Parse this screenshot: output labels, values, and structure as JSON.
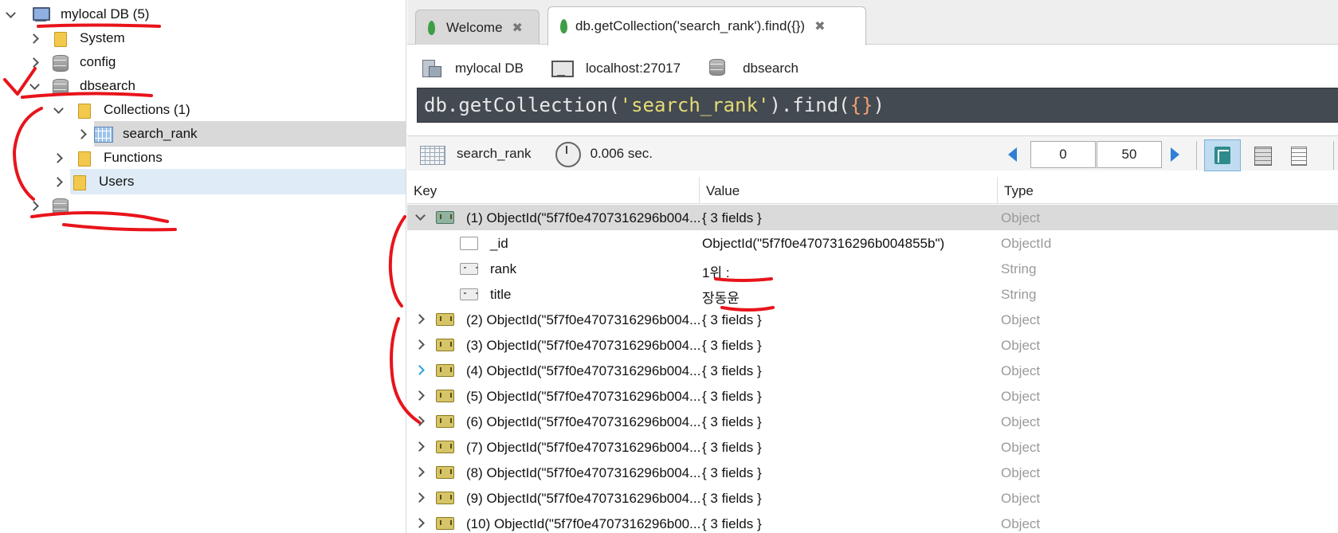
{
  "sidebar": {
    "items": [
      {
        "label": "mylocal DB (5)",
        "icon": "monitor-icon"
      },
      {
        "label": "System",
        "icon": "folder-icon"
      },
      {
        "label": "config",
        "icon": "database-icon"
      },
      {
        "label": "dbsearch",
        "icon": "database-icon"
      },
      {
        "label": "Collections (1)",
        "icon": "folder-icon"
      },
      {
        "label": "search_rank",
        "icon": "table-icon"
      },
      {
        "label": "Functions",
        "icon": "folder-icon"
      },
      {
        "label": "Users",
        "icon": "folder-icon"
      },
      {
        "label": "",
        "icon": "database-icon"
      }
    ]
  },
  "tabs": [
    {
      "label": "Welcome",
      "icon": "leaf-icon",
      "close": "✖"
    },
    {
      "label": "db.getCollection('search_rank').find({})",
      "icon": "leaf-icon",
      "close": "✖"
    }
  ],
  "connection": {
    "server": "mylocal DB",
    "host": "localhost:27017",
    "database": "dbsearch"
  },
  "query": {
    "p1": "db.getCollection(",
    "str": "'search_rank'",
    "p2": ").find(",
    "braces": "{}",
    "p3": ")"
  },
  "results_bar": {
    "collection": "search_rank",
    "time": "0.006 sec.",
    "page_start": "0",
    "page_size": "50"
  },
  "grid": {
    "headers": {
      "key": "Key",
      "value": "Value",
      "type": "Type"
    },
    "rows": [
      {
        "key": "(1) ObjectId(\"5f7f0e4707316296b004...",
        "value": "{ 3 fields }",
        "type": "Object"
      },
      {
        "key": "_id",
        "value": "ObjectId(\"5f7f0e4707316296b004855b\")",
        "type": "ObjectId"
      },
      {
        "key": "rank",
        "value": "1위 :",
        "type": "String"
      },
      {
        "key": "title",
        "value": "장동윤",
        "type": "String"
      },
      {
        "key": "(2) ObjectId(\"5f7f0e4707316296b004...",
        "value": "{ 3 fields }",
        "type": "Object"
      },
      {
        "key": "(3) ObjectId(\"5f7f0e4707316296b004...",
        "value": "{ 3 fields }",
        "type": "Object"
      },
      {
        "key": "(4) ObjectId(\"5f7f0e4707316296b004...",
        "value": "{ 3 fields }",
        "type": "Object"
      },
      {
        "key": "(5) ObjectId(\"5f7f0e4707316296b004...",
        "value": "{ 3 fields }",
        "type": "Object"
      },
      {
        "key": "(6) ObjectId(\"5f7f0e4707316296b004...",
        "value": "{ 3 fields }",
        "type": "Object"
      },
      {
        "key": "(7) ObjectId(\"5f7f0e4707316296b004...",
        "value": "{ 3 fields }",
        "type": "Object"
      },
      {
        "key": "(8) ObjectId(\"5f7f0e4707316296b004...",
        "value": "{ 3 fields }",
        "type": "Object"
      },
      {
        "key": "(9) ObjectId(\"5f7f0e4707316296b004...",
        "value": "{ 3 fields }",
        "type": "Object"
      },
      {
        "key": "(10) ObjectId(\"5f7f0e4707316296b00...",
        "value": "{ 3 fields }",
        "type": "Object"
      }
    ]
  },
  "colors": {
    "query_bg": "#434a52",
    "selected_row": "#dadada",
    "annotation_red": "#e8141b"
  }
}
